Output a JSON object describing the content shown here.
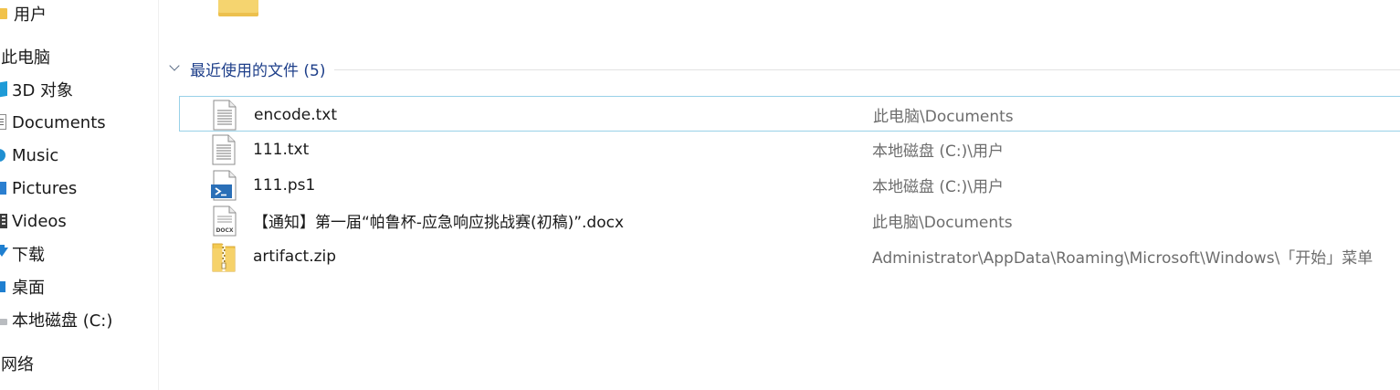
{
  "sidebar": {
    "items": [
      {
        "label": "用户",
        "icon": "folder-icon"
      },
      {
        "label": "此电脑",
        "icon": ""
      },
      {
        "label": "3D 对象",
        "icon": "3d-objects-icon"
      },
      {
        "label": "Documents",
        "icon": "documents-icon"
      },
      {
        "label": "Music",
        "icon": "music-icon"
      },
      {
        "label": "Pictures",
        "icon": "pictures-icon"
      },
      {
        "label": "Videos",
        "icon": "videos-icon"
      },
      {
        "label": "下载",
        "icon": "download-icon"
      },
      {
        "label": "桌面",
        "icon": "desktop-icon"
      },
      {
        "label": "本地磁盘 (C:)",
        "icon": "drive-icon"
      },
      {
        "label": "网络",
        "icon": ""
      }
    ]
  },
  "main": {
    "group": {
      "title": "最近使用的文件 (5)"
    },
    "files": [
      {
        "name": "encode.txt",
        "path": "此电脑\\Documents",
        "icon": "text-file-icon"
      },
      {
        "name": "111.txt",
        "path": "本地磁盘 (C:)\\用户",
        "icon": "text-file-icon"
      },
      {
        "name": "111.ps1",
        "path": "本地磁盘 (C:)\\用户",
        "icon": "powershell-file-icon"
      },
      {
        "name": "【通知】第一届“帕鲁杯-应急响应挑战赛(初稿)”.docx",
        "path": "此电脑\\Documents",
        "icon": "docx-file-icon"
      },
      {
        "name": "artifact.zip",
        "path": "Administrator\\AppData\\Roaming\\Microsoft\\Windows\\「开始」菜单",
        "icon": "zip-folder-icon"
      }
    ]
  },
  "colors": {
    "accent": "#1e3f8a",
    "focus_border": "#99d1e8",
    "path_text": "#6d6d6d"
  }
}
